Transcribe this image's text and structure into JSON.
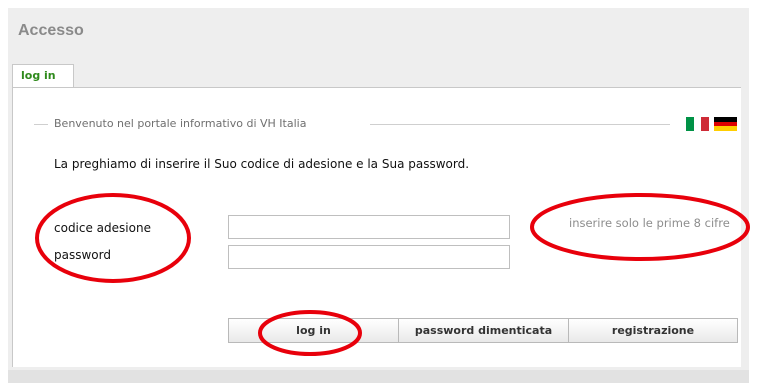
{
  "page": {
    "title": "Accesso"
  },
  "tabs": [
    {
      "label": "log in"
    }
  ],
  "legend": {
    "text": "Benvenuto nel portale informativo di VH Italia"
  },
  "languages": [
    {
      "code": "it",
      "icon": "italian-flag-icon",
      "colors": [
        "#009246",
        "#ffffff",
        "#ce2b37"
      ]
    },
    {
      "code": "de",
      "icon": "german-flag-icon",
      "colors": [
        "#000000",
        "#dd0000",
        "#ffce00"
      ]
    }
  ],
  "form": {
    "intro": "La preghiamo di inserire il Suo codice di adesione e la Sua password.",
    "code_label": "codice adesione",
    "code_value": "",
    "password_label": "password",
    "password_value": "",
    "hint": "inserire solo le prime 8 cifre"
  },
  "buttons": {
    "login": "log in",
    "forgot": "password dimenticata",
    "register": "registrazione"
  },
  "annotations": {
    "color": "#e8000b"
  }
}
